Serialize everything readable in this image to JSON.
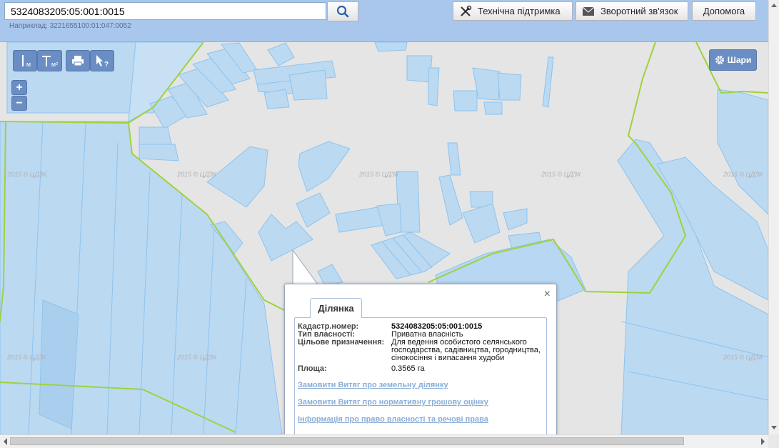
{
  "search": {
    "value": "5324083205:05:001:0015",
    "example": "Наприклад: 3221655100:01:047:0052"
  },
  "header_buttons": {
    "support": "Технічна підтримка",
    "feedback": "Зворотний зв'язок",
    "help": "Допомога"
  },
  "map_tools": {
    "measure_length": "м",
    "measure_area": "м²",
    "zoom_in": "+",
    "zoom_out": "−",
    "layers": "Шари"
  },
  "watermark": "2015 © ЦДЗК",
  "popup": {
    "close": "×",
    "tab": "Ділянка",
    "fields": [
      {
        "label": "Кадастр.номер:",
        "value": "5324083205:05:001:0015"
      },
      {
        "label": "Тип власності:",
        "value": "Приватна власність"
      },
      {
        "label": "Цільове призначення:",
        "value": "Для ведення особистого селянського господарства, садівництва, городництва, сінокосіння і випасання худоби"
      },
      {
        "label": "Площа:",
        "value": "0.3565 га"
      }
    ],
    "links": [
      "Замовити Витяг про земельну ділянку",
      "Замовити Витяг про нормативну грошову оцінку",
      "Інформація про право власності та речові права"
    ]
  },
  "colors": {
    "header": "#a9c6ec",
    "map_bg": "#e5e5e5",
    "parcel_fill": "#bcd9f2",
    "parcel_stroke": "#8cc4ee",
    "boundary": "#9ed23e",
    "tool_bg": "#6a8ec4"
  }
}
